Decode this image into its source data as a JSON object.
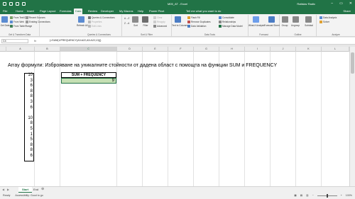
{
  "window": {
    "title": "M05_AT - Excel",
    "user": "Ratislav Radic",
    "minimize": "–",
    "restore": "▭",
    "close": "✕"
  },
  "tabs": [
    "File",
    "Home",
    "Insert",
    "Page Layout",
    "Formulas",
    "Data",
    "Review",
    "Developer",
    "My Macros",
    "Help",
    "Power Pivot"
  ],
  "active_tab": "Data",
  "tell_me": "Tell me what you want to do",
  "share": "Share",
  "ribbon": {
    "get_data": "Get Data",
    "from_text": "From Text/CSV",
    "from_web": "From Web",
    "from_table": "From Table/Range",
    "recent_sources": "Recent Sources",
    "existing_connections": "Existing Connections",
    "group_get": "Get & Transform Data",
    "refresh_all": "Refresh All",
    "queries": "Queries & Connections",
    "properties": "Properties",
    "edit_links": "Edit Links",
    "group_queries": "Queries & Connections",
    "sort_az": "A→Z",
    "sort_za": "Z→A",
    "sort": "Sort",
    "filter": "Filter",
    "clear": "Clear",
    "reapply": "Reapply",
    "advanced": "Advanced",
    "group_sort": "Sort & Filter",
    "text_to_columns": "Text to Columns",
    "flash_fill": "Flash Fill",
    "remove_duplicates": "Remove Duplicates",
    "data_validation": "Data Validation",
    "consolidate": "Consolidate",
    "relationships": "Relationships",
    "manage_data_model": "Manage Data Model",
    "group_tools": "Data Tools",
    "what_if": "What-If Analysis",
    "forecast_sheet": "Forecast Sheet",
    "group_forecast": "Forecast",
    "group_btn": "Group",
    "ungroup": "Ungroup",
    "subtotal": "Subtotal",
    "group_outline": "Outline",
    "data_analysis": "Data Analysis",
    "solver": "Solver",
    "group_analyze": "Analyze"
  },
  "formula_bar": {
    "name_box": "C4",
    "fx": "fx",
    "formula": "{=SUM(1/FREQUENCY(A3:A22,A3:A22,13))}"
  },
  "columns": [
    "A",
    "B",
    "C",
    "D",
    "E",
    "F",
    "G",
    "H",
    "I",
    "J",
    "K",
    "L",
    "M"
  ],
  "rows": [
    "1",
    "2",
    "3",
    "4",
    "5",
    "6",
    "7",
    "8",
    "9",
    "10",
    "11",
    "12",
    "13",
    "14",
    "15",
    "16",
    "17",
    "18",
    "19",
    "20",
    "21",
    "22",
    "23",
    "24"
  ],
  "sheet": {
    "heading": "Array формули: Изброяване на уникалните стойности от дадена област с помощта на функции SUM и FREQUENCY",
    "colA_values": [
      "10",
      "3",
      "6",
      "8",
      "8",
      "3",
      "6",
      "",
      "10",
      "8",
      "5",
      "1",
      "5",
      "8",
      "8",
      "6",
      "10",
      "14",
      "18"
    ],
    "result_header": "SUM + FREQUENCY",
    "result_value": "9"
  },
  "sheet_tabs": [
    "Start",
    "End"
  ],
  "active_sheet": "Start",
  "add_sheet": "⊕",
  "status": {
    "ready": "Ready",
    "accessibility": "Accessibility: Good to go",
    "zoom": "100%"
  },
  "colors": {
    "excel_green": "#217346",
    "result_fill": "#c6e0b4"
  }
}
